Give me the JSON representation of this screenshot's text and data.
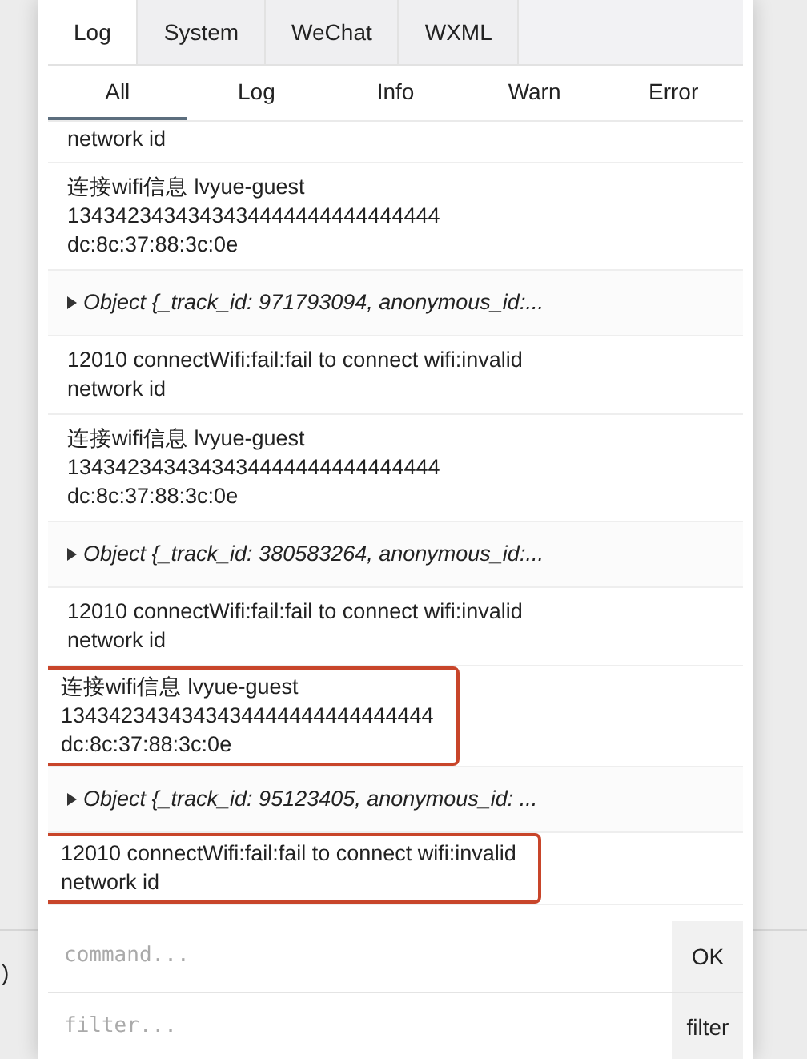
{
  "tabs": [
    {
      "label": "Log",
      "selected": true
    },
    {
      "label": "System",
      "selected": false
    },
    {
      "label": "WeChat",
      "selected": false
    },
    {
      "label": "WXML",
      "selected": false
    }
  ],
  "level_filters": [
    {
      "label": "All",
      "selected": true
    },
    {
      "label": "Log",
      "selected": false
    },
    {
      "label": "Info",
      "selected": false
    },
    {
      "label": "Warn",
      "selected": false
    },
    {
      "label": "Error",
      "selected": false
    }
  ],
  "entries": [
    {
      "kind": "text",
      "lines": [
        "network id"
      ],
      "highlighted": false
    },
    {
      "kind": "text",
      "lines": [
        "连接wifi信息 lvyue-guest",
        "1343423434343434444444444444444",
        "dc:8c:37:88:3c:0e"
      ],
      "highlighted": false
    },
    {
      "kind": "object",
      "lines": [
        "Object {_track_id: 971793094, anonymous_id:..."
      ],
      "highlighted": false
    },
    {
      "kind": "text",
      "lines": [
        "12010 connectWifi:fail:fail to connect wifi:invalid",
        "network id"
      ],
      "highlighted": false
    },
    {
      "kind": "text",
      "lines": [
        "连接wifi信息 lvyue-guest",
        "1343423434343434444444444444444",
        "dc:8c:37:88:3c:0e"
      ],
      "highlighted": false
    },
    {
      "kind": "object",
      "lines": [
        "Object {_track_id: 380583264, anonymous_id:..."
      ],
      "highlighted": false
    },
    {
      "kind": "text",
      "lines": [
        "12010 connectWifi:fail:fail to connect wifi:invalid",
        "network id"
      ],
      "highlighted": false
    },
    {
      "kind": "text",
      "lines": [
        "连接wifi信息 lvyue-guest",
        "1343423434343434444444444444444",
        "dc:8c:37:88:3c:0e"
      ],
      "highlighted": true
    },
    {
      "kind": "object",
      "lines": [
        "Object {_track_id: 95123405, anonymous_id: ..."
      ],
      "highlighted": false
    },
    {
      "kind": "text",
      "lines": [
        "12010 connectWifi:fail:fail to connect wifi:invalid",
        "network id"
      ],
      "highlighted": true
    }
  ],
  "command": {
    "placeholder": "command...",
    "button": "OK"
  },
  "filter": {
    "placeholder": "filter...",
    "button": "filter"
  },
  "edge_text": ")"
}
